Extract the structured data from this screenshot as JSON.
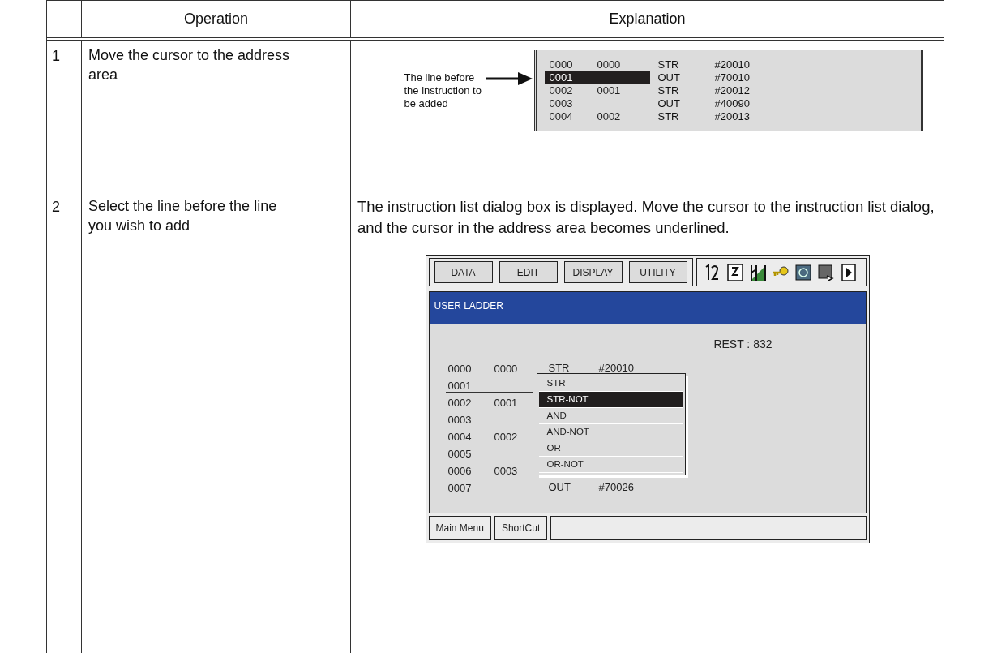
{
  "table": {
    "columns": [
      "Operation",
      "Explanation"
    ],
    "rows": [
      {
        "number": "1",
        "operation": "Move the cursor to the address area",
        "figure": {
          "callout": "The line before the instruction to be added",
          "lines": [
            {
              "address": "0000",
              "step": "0000",
              "instruction": "STR",
              "operand": "#20010",
              "selected": false
            },
            {
              "address": "0001",
              "instruction": "OUT",
              "operand": "#70010",
              "selected": true
            },
            {
              "address": "0002",
              "step": "0001",
              "instruction": "STR",
              "operand": "#20012",
              "selected": false
            },
            {
              "address": "0003",
              "instruction": "OUT",
              "operand": "#40090",
              "selected": false
            },
            {
              "address": "0004",
              "step": "0002",
              "instruction": "STR",
              "operand": "#20013",
              "selected": false
            }
          ]
        }
      },
      {
        "number": "2",
        "operation": "Select the line before the line you wish to add",
        "explanation": "The instruction list dialog box is displayed.  Move the cursor to the instruction list dialog, and the cursor in the address area becomes underlined.",
        "screen": {
          "menu": [
            "DATA",
            "EDIT",
            "DISPLAY",
            "UTILITY"
          ],
          "title": "USER LADDER",
          "rest": "REST : 832",
          "lines": [
            {
              "address": "0000",
              "step": "0000",
              "instruction": "STR",
              "operand": "#20010",
              "cursor": false
            },
            {
              "address": "0001",
              "cursor": true
            },
            {
              "address": "0002",
              "step": "0001",
              "cursor": false
            },
            {
              "address": "0003",
              "cursor": false
            },
            {
              "address": "0004",
              "step": "0002",
              "cursor": false
            },
            {
              "address": "0005",
              "cursor": false
            },
            {
              "address": "0006",
              "step": "0003",
              "cursor": false
            },
            {
              "address": "0007",
              "instruction": "OUT",
              "operand": "#70026",
              "cursor": false
            }
          ],
          "dropdown": [
            {
              "label": "STR",
              "selected": false
            },
            {
              "label": "STR-NOT",
              "selected": true
            },
            {
              "label": "AND",
              "selected": false
            },
            {
              "label": "AND-NOT",
              "selected": false
            },
            {
              "label": "OR",
              "selected": false
            },
            {
              "label": "OR-NOT",
              "selected": false
            }
          ],
          "bottom": [
            "Main Menu",
            "ShortCut"
          ]
        }
      }
    ]
  }
}
